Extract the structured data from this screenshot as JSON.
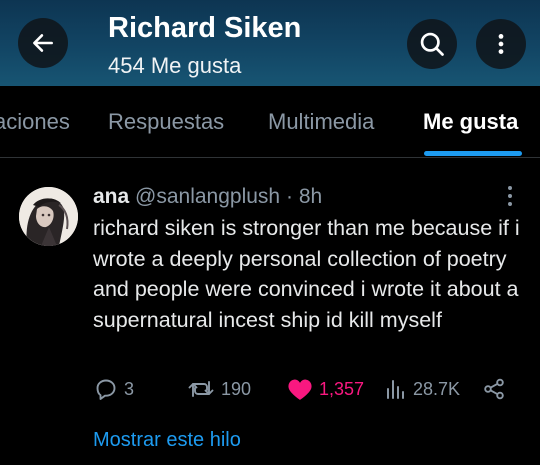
{
  "header": {
    "title": "Richard Siken",
    "subtitle": "454 Me gusta"
  },
  "icons": {
    "back": "arrow-left-icon",
    "search": "search-icon",
    "more": "more-vertical-icon"
  },
  "tabs": [
    {
      "label": "aciones",
      "active": false
    },
    {
      "label": "Respuestas",
      "active": false
    },
    {
      "label": "Multimedia",
      "active": false
    },
    {
      "label": "Me gusta",
      "active": true
    }
  ],
  "post": {
    "author": "ana",
    "handle": "@sanlangplush",
    "separator": "·",
    "time": "8h",
    "text": "richard siken is stronger than me because if i wrote a deeply personal collection of poetry and people were convinced i wrote it about a supernatural incest ship id kill myself",
    "actions": {
      "replies": "3",
      "reposts": "190",
      "likes": "1,357",
      "views": "28.7K"
    },
    "show_thread": "Mostrar este hilo"
  },
  "colors": {
    "accent": "#1d9bf0",
    "like": "#f91880",
    "muted": "#8b98a5",
    "background": "#000000"
  }
}
